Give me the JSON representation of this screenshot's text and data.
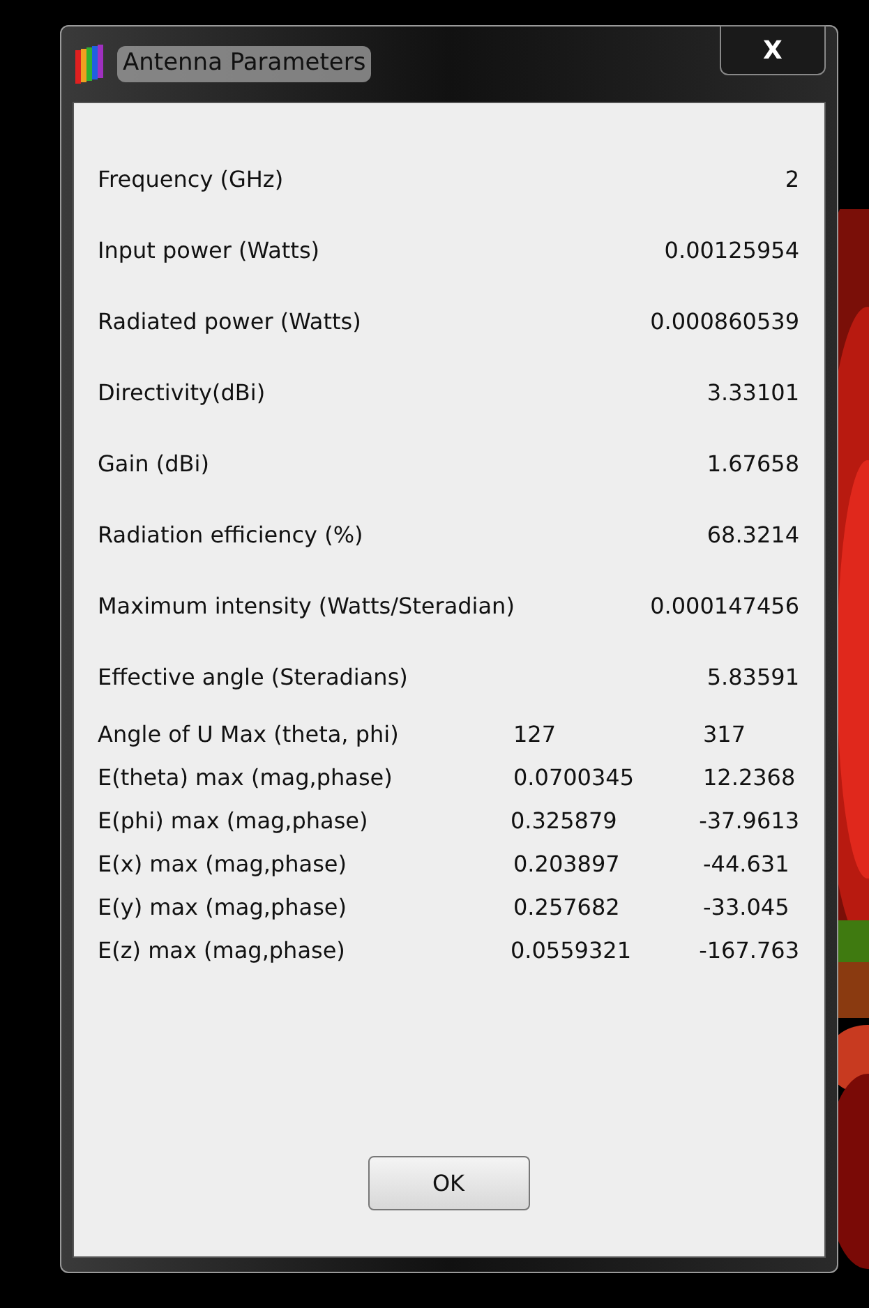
{
  "window": {
    "title": "Antenna Parameters",
    "close_label": "X"
  },
  "parameters": [
    {
      "kind": "single",
      "label": "Frequency (GHz)",
      "value": "2"
    },
    {
      "kind": "single",
      "label": "Input power (Watts)",
      "value": "0.00125954"
    },
    {
      "kind": "single",
      "label": "Radiated power (Watts)",
      "value": "0.000860539"
    },
    {
      "kind": "single",
      "label": "Directivity(dBi)",
      "value": "3.33101"
    },
    {
      "kind": "single",
      "label": "Gain (dBi)",
      "value": "1.67658"
    },
    {
      "kind": "single",
      "label": "Radiation efficiency (%)",
      "value": "68.3214"
    },
    {
      "kind": "single",
      "label": "Maximum intensity (Watts/Steradian)",
      "value": "0.000147456"
    },
    {
      "kind": "single",
      "label": "Effective angle (Steradians)",
      "value": "5.83591"
    },
    {
      "kind": "pair",
      "label": "Angle of U Max (theta, phi)",
      "value": "127",
      "value_2": "317"
    },
    {
      "kind": "pair",
      "label": "E(theta) max (mag,phase)",
      "value": "0.0700345",
      "value_2": "12.2368"
    },
    {
      "kind": "pair",
      "label": "E(phi) max (mag,phase)",
      "value": "0.325879",
      "value_2": "-37.9613"
    },
    {
      "kind": "pair",
      "label": "E(x) max (mag,phase)",
      "value": "0.203897",
      "value_2": "-44.631"
    },
    {
      "kind": "pair",
      "label": "E(y) max (mag,phase)",
      "value": "0.257682",
      "value_2": "-33.045"
    },
    {
      "kind": "pair",
      "label": "E(z) max (mag,phase)",
      "value": "0.0559321",
      "value_2": "-167.763"
    }
  ],
  "buttons": [
    "OK"
  ]
}
